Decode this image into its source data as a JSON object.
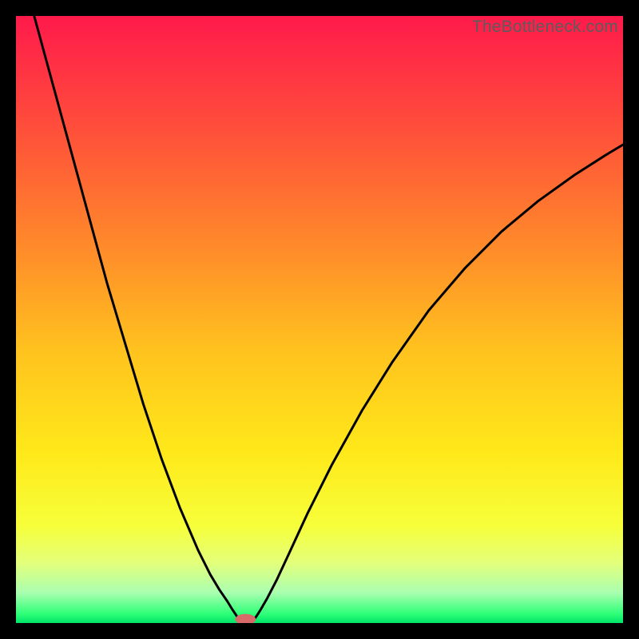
{
  "watermark": "TheBottleneck.com",
  "chart_data": {
    "type": "line",
    "title": "",
    "xlabel": "",
    "ylabel": "",
    "xlim": [
      0,
      100
    ],
    "ylim": [
      0,
      100
    ],
    "grid": false,
    "legend": false,
    "gradient_stops": [
      {
        "offset": 0.0,
        "color": "#ff1a4b"
      },
      {
        "offset": 0.18,
        "color": "#ff4d3b"
      },
      {
        "offset": 0.38,
        "color": "#ff8a2a"
      },
      {
        "offset": 0.55,
        "color": "#ffc21e"
      },
      {
        "offset": 0.72,
        "color": "#ffe91a"
      },
      {
        "offset": 0.84,
        "color": "#f6ff3a"
      },
      {
        "offset": 0.9,
        "color": "#e4ff7a"
      },
      {
        "offset": 0.95,
        "color": "#aaffb0"
      },
      {
        "offset": 0.985,
        "color": "#2eff77"
      },
      {
        "offset": 1.0,
        "color": "#00e56a"
      }
    ],
    "series": [
      {
        "name": "left-branch",
        "x": [
          3,
          6,
          9,
          12,
          15,
          18,
          21,
          24,
          27,
          30,
          32,
          33.5,
          34.8,
          35.6,
          36.2,
          36.6,
          36.9,
          37.05
        ],
        "y": [
          100,
          89,
          78,
          67,
          56,
          46,
          36,
          27,
          19,
          12,
          8,
          5.5,
          3.6,
          2.3,
          1.4,
          0.8,
          0.35,
          0.1
        ]
      },
      {
        "name": "right-branch",
        "x": [
          38.8,
          39.1,
          39.6,
          40.3,
          41.4,
          43,
          45,
          48,
          52,
          57,
          62,
          68,
          74,
          80,
          86,
          92,
          97,
          100
        ],
        "y": [
          0.1,
          0.45,
          1.1,
          2.2,
          4.1,
          7.2,
          11.5,
          18,
          26,
          35,
          43,
          51.5,
          58.5,
          64.5,
          69.5,
          73.8,
          77,
          78.8
        ]
      }
    ],
    "marker": {
      "x": 37.8,
      "y": 0.6,
      "rx": 1.7,
      "ry": 0.9,
      "fill": "#d86a6a"
    }
  }
}
